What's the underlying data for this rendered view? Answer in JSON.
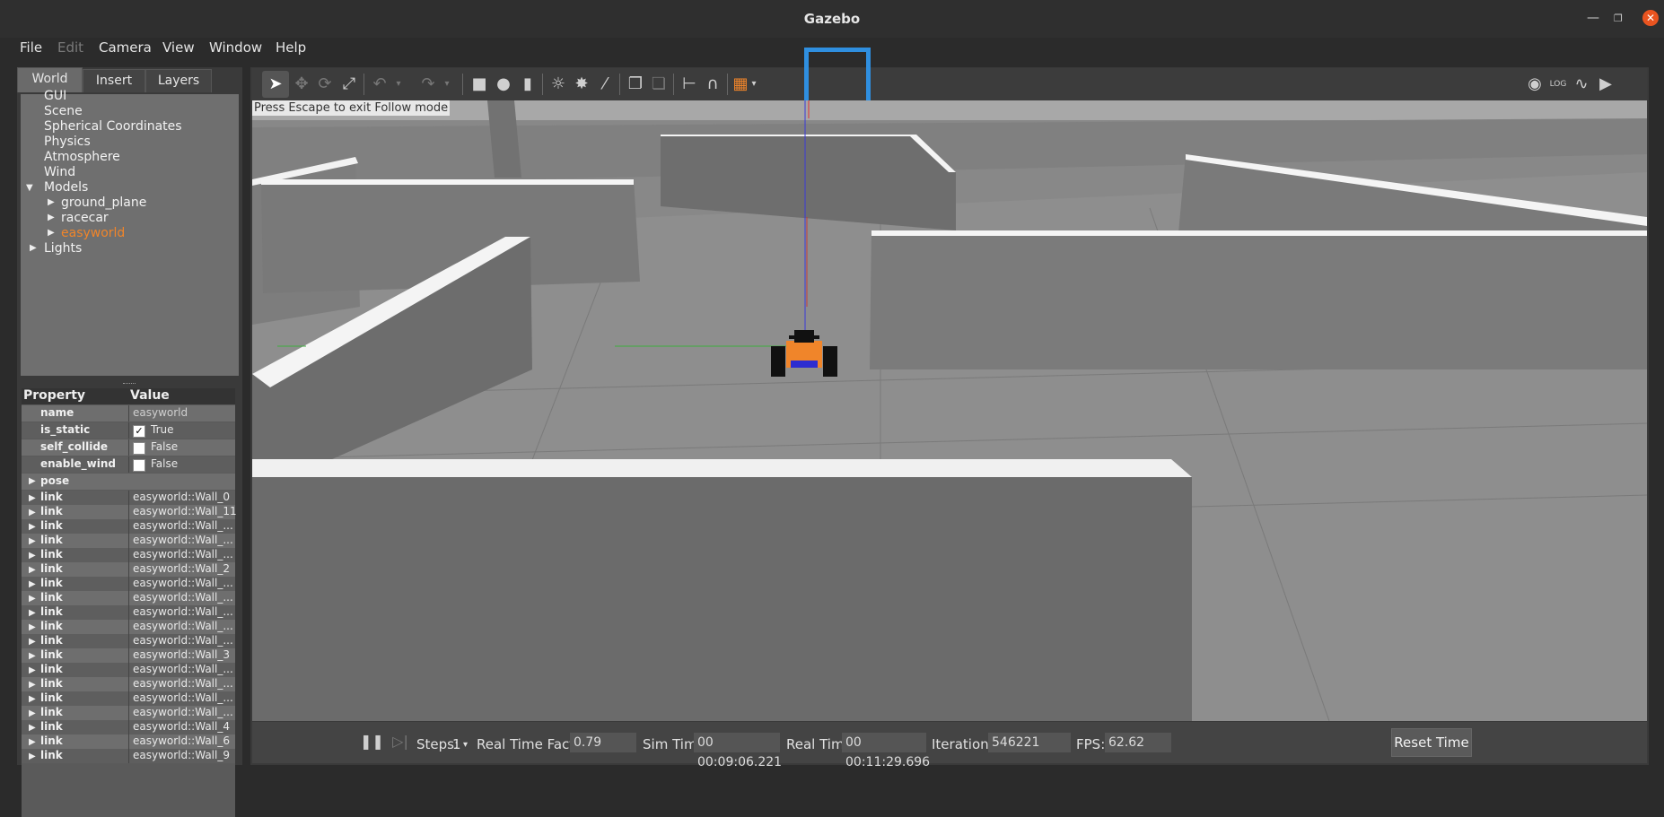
{
  "window": {
    "title": "Gazebo"
  },
  "menu": {
    "file": "File",
    "edit": "Edit",
    "camera": "Camera",
    "view": "View",
    "window": "Window",
    "help": "Help"
  },
  "tabs": {
    "world": "World",
    "insert": "Insert",
    "layers": "Layers"
  },
  "tree": {
    "gui": "GUI",
    "scene": "Scene",
    "spherical": "Spherical Coordinates",
    "physics": "Physics",
    "atmosphere": "Atmosphere",
    "wind": "Wind",
    "models": "Models",
    "ground_plane": "ground_plane",
    "racecar": "racecar",
    "easyworld": "easyworld",
    "lights": "Lights"
  },
  "properties": {
    "col_property": "Property",
    "col_value": "Value",
    "name_key": "name",
    "name_val": "easyworld",
    "is_static_key": "is_static",
    "is_static_val": "True",
    "self_collide_key": "self_collide",
    "self_collide_val": "False",
    "enable_wind_key": "enable_wind",
    "enable_wind_val": "False",
    "pose_key": "pose",
    "link_key": "link",
    "links": [
      "easyworld::Wall_0",
      "easyworld::Wall_11",
      "easyworld::Wall_...",
      "easyworld::Wall_...",
      "easyworld::Wall_...",
      "easyworld::Wall_2",
      "easyworld::Wall_...",
      "easyworld::Wall_...",
      "easyworld::Wall_...",
      "easyworld::Wall_...",
      "easyworld::Wall_...",
      "easyworld::Wall_3",
      "easyworld::Wall_...",
      "easyworld::Wall_...",
      "easyworld::Wall_...",
      "easyworld::Wall_...",
      "easyworld::Wall_4",
      "easyworld::Wall_6",
      "easyworld::Wall_9"
    ]
  },
  "viewport": {
    "follow_msg": "Press Escape to exit Follow mode"
  },
  "status": {
    "steps_label": "Steps:",
    "steps_value": "1",
    "rtf_label": "Real Time Factor:",
    "rtf_value": "0.79",
    "sim_label": "Sim Time:",
    "sim_value": "00 00:09:06.221",
    "real_label": "Real Time:",
    "real_value": "00 00:11:29.696",
    "iter_label": "Iterations:",
    "iter_value": "546221",
    "fps_label": "FPS:",
    "fps_value": "62.62",
    "reset_label": "Reset Time"
  },
  "colors": {
    "accent_orange": "#f0852a",
    "highlight_blue": "#2f8fe0"
  }
}
